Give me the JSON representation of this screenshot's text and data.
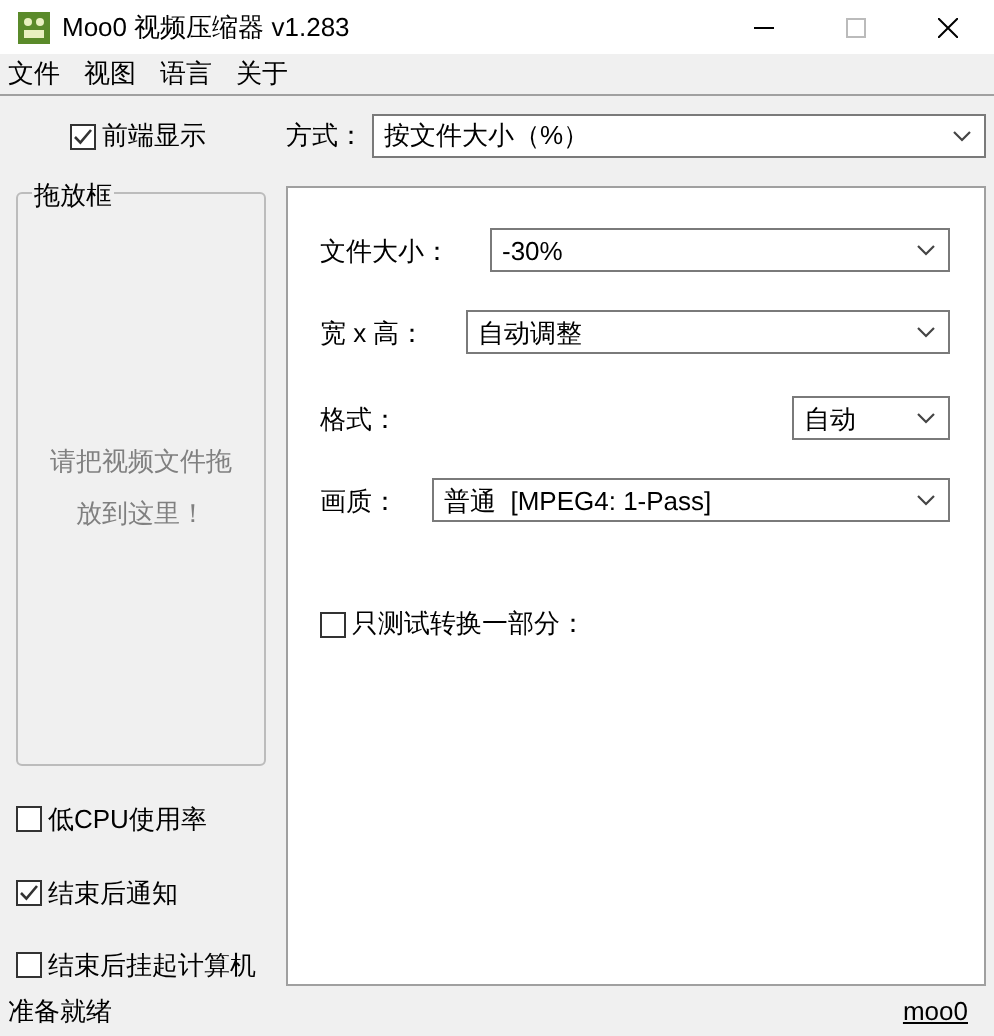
{
  "window": {
    "title": "Moo0 视频压缩器 v1.283"
  },
  "menu": [
    "文件",
    "视图",
    "语言",
    "关于"
  ],
  "always_on_top": {
    "label": "前端显示",
    "checked": true
  },
  "method": {
    "label": "方式：",
    "value": "按文件大小（%）"
  },
  "drop_zone": {
    "title": "拖放框",
    "hint": "请把视频文件拖放到这里！"
  },
  "options": [
    {
      "label": "低CPU使用率",
      "checked": false
    },
    {
      "label": "结束后通知",
      "checked": true
    },
    {
      "label": "结束后挂起计算机",
      "checked": false
    }
  ],
  "settings": [
    {
      "label": "文件大小：",
      "value": "-30%"
    },
    {
      "label": "宽 x 高：",
      "value": "自动调整"
    },
    {
      "label": "格式：",
      "value": "自动"
    },
    {
      "label": "画质：",
      "value": "普通  [MPEG4: 1-Pass]"
    }
  ],
  "test_part": {
    "label": "只测试转换一部分：",
    "checked": false
  },
  "status_bar": {
    "text": "准备就绪",
    "link": "moo0"
  }
}
